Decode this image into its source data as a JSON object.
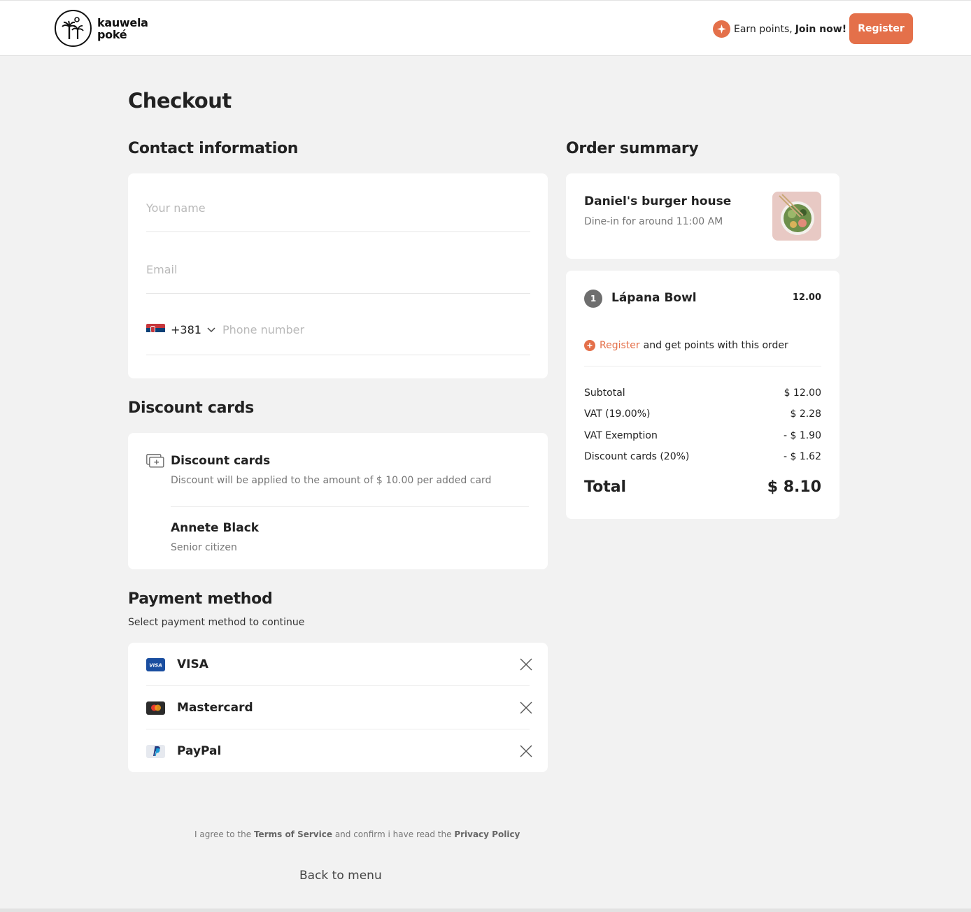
{
  "header": {
    "logo_line1": "kauwela",
    "logo_line2": "poké",
    "earn_text": "Earn points,",
    "earn_link": "Join now!",
    "register_label": "Register"
  },
  "page_title": "Checkout",
  "contact": {
    "heading": "Contact information",
    "name_placeholder": "Your name",
    "email_placeholder": "Email",
    "country_code": "+381",
    "phone_placeholder": "Phone number"
  },
  "discount": {
    "heading": "Discount cards",
    "card_title": "Discount cards",
    "card_desc": "Discount will be applied to the amount of $ 10.00 per added card",
    "holder_name": "Annete Black",
    "holder_type": "Senior citizen"
  },
  "payment": {
    "heading": "Payment method",
    "subtitle": "Select payment method to continue",
    "methods": [
      {
        "label": "VISA",
        "icon": "visa-icon"
      },
      {
        "label": "Mastercard",
        "icon": "mastercard-icon"
      },
      {
        "label": "PayPal",
        "icon": "paypal-icon"
      }
    ]
  },
  "order": {
    "heading": "Order summary",
    "restaurant": "Daniel's burger house",
    "dine_info": "Dine-in for around 11:00 AM",
    "item_qty": "1",
    "item_name": "Lápana Bowl",
    "item_price": "12.00",
    "register_link": "Register",
    "register_text": "and get points with this order",
    "lines": [
      {
        "label": "Subtotal",
        "value": "$ 12.00"
      },
      {
        "label": "VAT (19.00%)",
        "value": "$ 2.28"
      },
      {
        "label": "VAT Exemption",
        "value": "- $ 1.90"
      },
      {
        "label": "Discount cards (20%)",
        "value": "- $ 1.62"
      }
    ],
    "total_label": "Total",
    "total_value": "$ 8.10"
  },
  "footer": {
    "agree_1": "I agree to the",
    "terms": "Terms of Service",
    "agree_2": "and confirm i have read the",
    "privacy": "Privacy Policy",
    "back_label": "Back to menu"
  },
  "colors": {
    "accent": "#e4704a",
    "background": "#f2f2f2",
    "card": "#ffffff"
  }
}
